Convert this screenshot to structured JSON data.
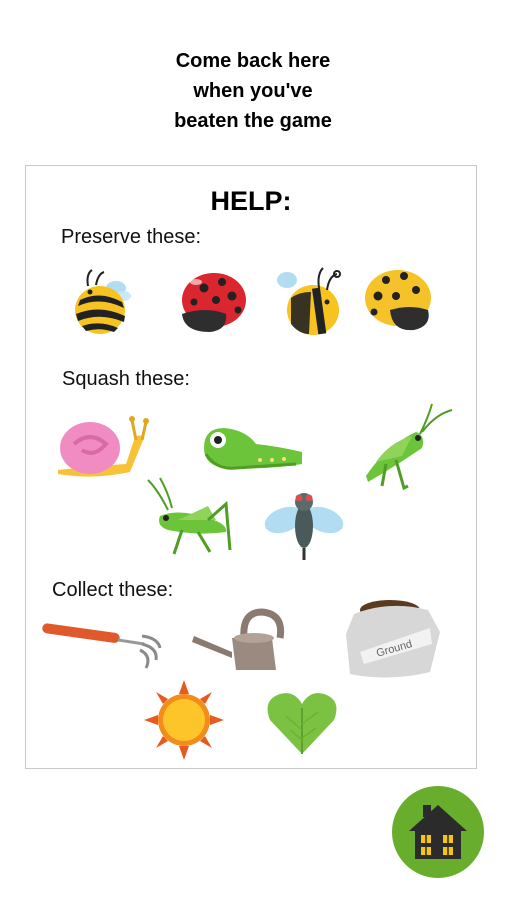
{
  "intro": {
    "line1": "Come back here",
    "line2": "when you've",
    "line3": "beaten the game"
  },
  "help": {
    "title": "HELP:",
    "preserve": {
      "label": "Preserve these:",
      "items": [
        "bee",
        "ladybug",
        "bee",
        "yellow-ladybug"
      ]
    },
    "squash": {
      "label": "Squash these:",
      "items": [
        "snail",
        "caterpillar",
        "grasshopper",
        "grasshopper",
        "fly"
      ]
    },
    "collect": {
      "label": "Collect these:",
      "items": [
        "hand-rake",
        "watering-can",
        "soil-bag",
        "sun",
        "leaf-heart"
      ]
    },
    "soil_bag_text": "Ground"
  },
  "home_button": {
    "icon": "house-icon",
    "color": "#69ad2d"
  },
  "colors": {
    "bee_yellow": "#f7c320",
    "ladybug_red": "#d9262f",
    "ladybug_yellow": "#f5c22a",
    "pest_green": "#6cc43a",
    "snail_pink": "#f08cc2",
    "leaf_green": "#7bc142"
  }
}
